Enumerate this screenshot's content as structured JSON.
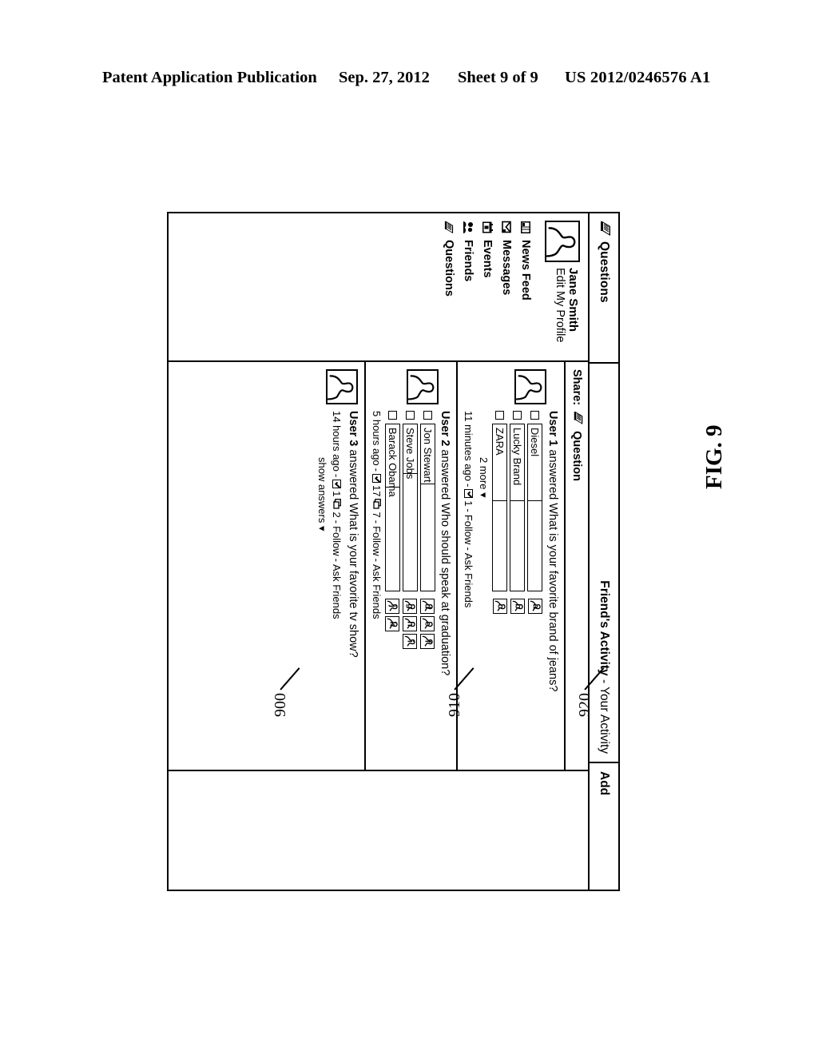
{
  "patent_header": {
    "publication": "Patent Application Publication",
    "date": "Sep. 27, 2012",
    "sheet": "Sheet 9 of 9",
    "number": "US 2012/0246576 A1"
  },
  "figure": {
    "label": "FIG. 9",
    "reference_numerals": [
      "900",
      "910",
      "920"
    ]
  },
  "topbar": {
    "questions_icon": "questions-book-icon",
    "questions_title": "Questions",
    "friends_activity": "Friend's Activity",
    "activity_separator": " - ",
    "your_activity": "Your Activity",
    "add_label": "Add"
  },
  "sidebar": {
    "avatar_icon": "user-silhouette-icon",
    "profile_name": "Jane Smith",
    "edit_profile": "Edit My Profile",
    "items": [
      {
        "label": "News Feed",
        "icon": "newspaper-icon"
      },
      {
        "label": "Messages",
        "icon": "envelope-icon"
      },
      {
        "label": "Events",
        "icon": "calendar-icon"
      },
      {
        "label": "Friends",
        "icon": "people-icon"
      },
      {
        "label": "Questions",
        "icon": "questions-book-icon"
      }
    ]
  },
  "share": {
    "label": "Share:",
    "kind_icon": "questions-book-icon",
    "kind_label": "Question"
  },
  "posts": [
    {
      "ref": "900",
      "avatar_icon": "user-silhouette-icon",
      "author": "User 1",
      "verb": "answered",
      "question": "What is your favorite brand of jeans?",
      "answers": [
        {
          "text": "Diesel",
          "fill_pct": 46,
          "voters": [
            "a"
          ]
        },
        {
          "text": "Lucky Brand",
          "fill_pct": 46,
          "voters": [
            "b"
          ]
        },
        {
          "text": "ZARA",
          "fill_pct": 46,
          "voters": [
            "c"
          ]
        }
      ],
      "more_label": "2 more",
      "more_caret": "▾",
      "meta": {
        "time": "11 minutes ago",
        "sep": " - ",
        "vote_count": "1",
        "comment_count": null,
        "follow": "Follow",
        "ask": "Ask Friends"
      },
      "show_answers": null
    },
    {
      "ref": "910",
      "avatar_icon": "user-silhouette-icon",
      "author": "User 2",
      "verb": "answered",
      "question": "Who should speak at graduation?",
      "answers": [
        {
          "text": "Jon Stewart",
          "fill_pct": 36,
          "voters": [
            "d",
            "e",
            "f"
          ]
        },
        {
          "text": "Steve Jobs",
          "fill_pct": 30,
          "voters": [
            "g",
            "h",
            "i"
          ]
        },
        {
          "text": "Barack Obama",
          "fill_pct": 38,
          "voters": [
            "j",
            "k"
          ]
        }
      ],
      "more_label": null,
      "more_caret": null,
      "meta": {
        "time": "5 hours ago",
        "sep": " - ",
        "vote_count": "17",
        "comment_count": "7",
        "follow": "Follow",
        "ask": "Ask Friends"
      },
      "show_answers": null
    },
    {
      "ref": "920",
      "avatar_icon": "user-silhouette-icon",
      "author": "User 3",
      "verb": "answered",
      "question": "What is your favorite tv show?",
      "answers": [],
      "more_label": null,
      "more_caret": null,
      "meta": {
        "time": "14 hours ago",
        "sep": " - ",
        "vote_count": "1",
        "comment_count": "2",
        "follow": "Follow",
        "ask": "Ask Friends"
      },
      "show_answers": "show answers",
      "show_answers_caret": "▾"
    }
  ]
}
